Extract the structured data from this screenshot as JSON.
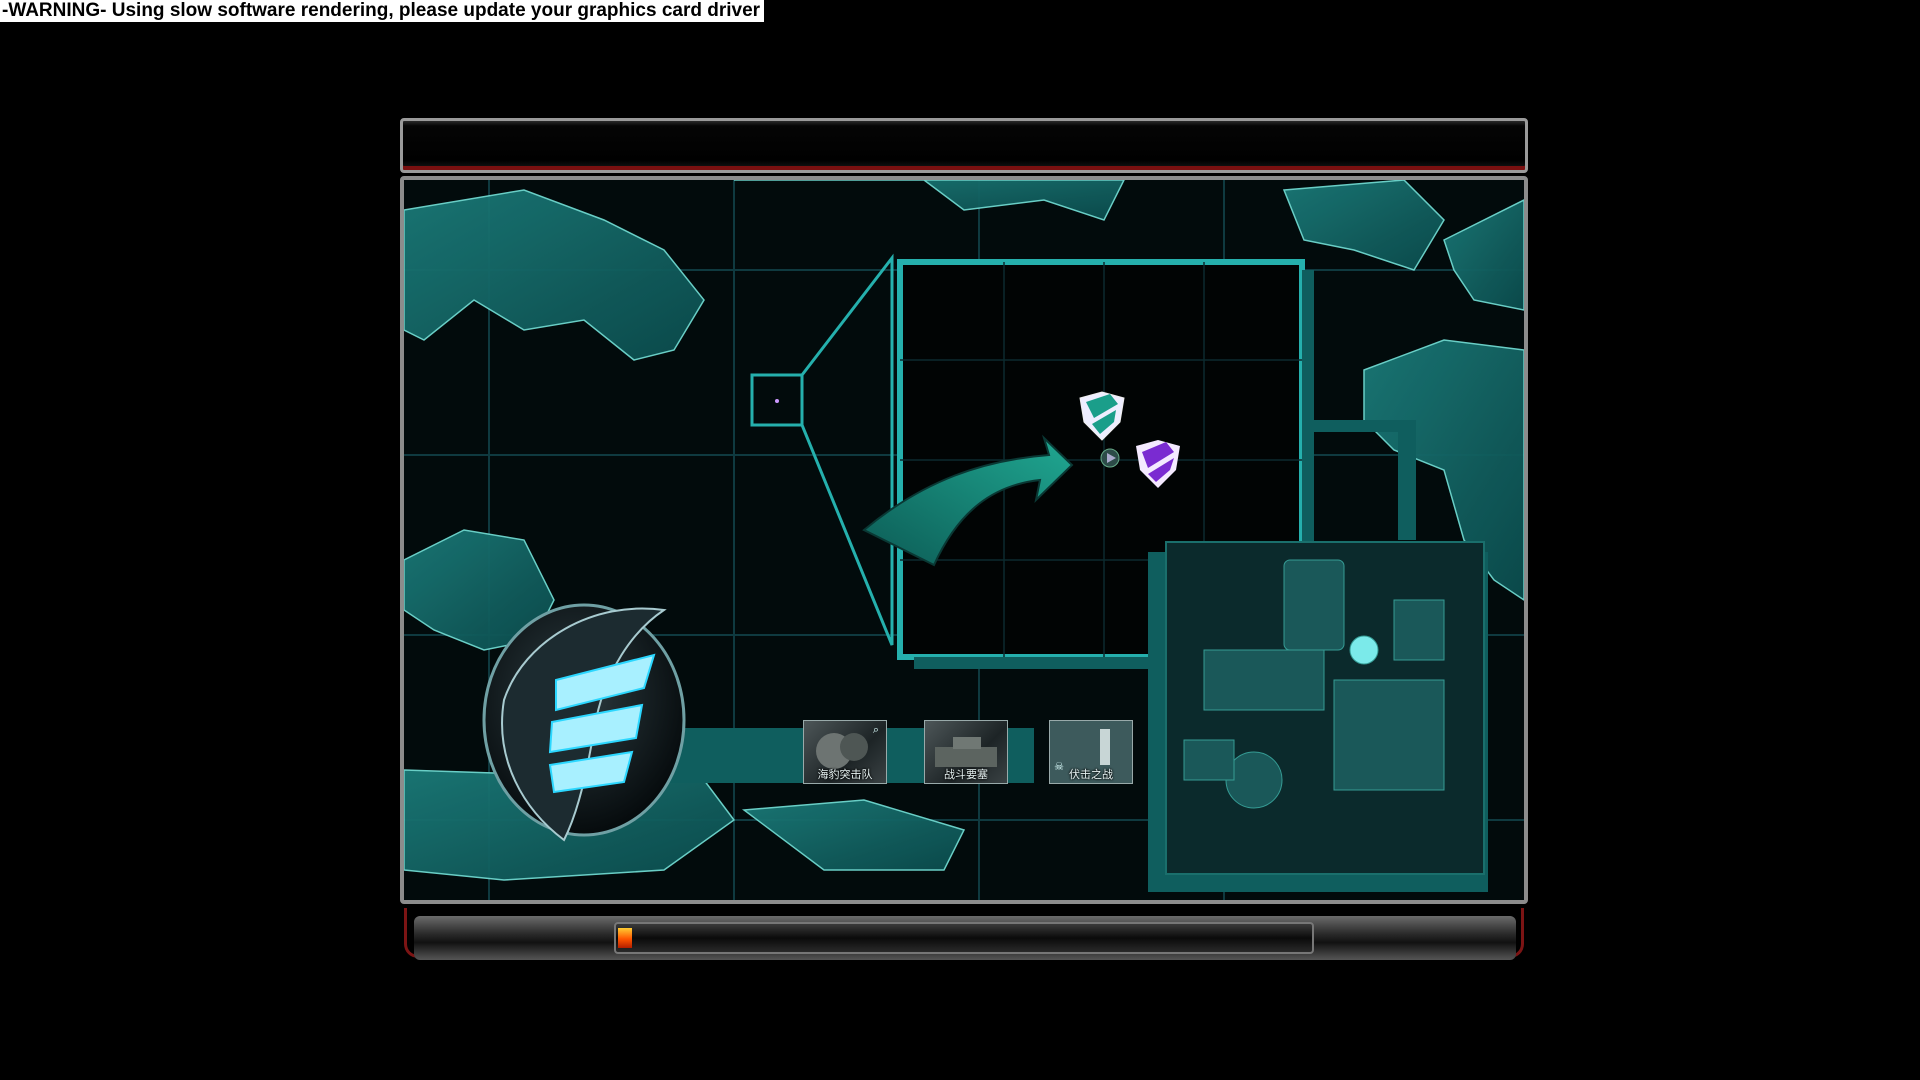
{
  "warning": "-WARNING- Using slow software rendering, please update your graphics card driver",
  "mission_cards": [
    {
      "label": "海豹突击队",
      "icon": "magnifier-icon"
    },
    {
      "label": "战斗要塞",
      "icon": "tank-icon"
    },
    {
      "label": "伏击之战",
      "icon": "skull-icon"
    }
  ],
  "progress": 0.02,
  "colors": {
    "map_teal": "#0f5e5e",
    "map_highlight": "#1fa39a",
    "allied_shield": "#1a9e8a",
    "soviet_shield": "#7a2bd1",
    "frame_red": "#8a1414"
  }
}
